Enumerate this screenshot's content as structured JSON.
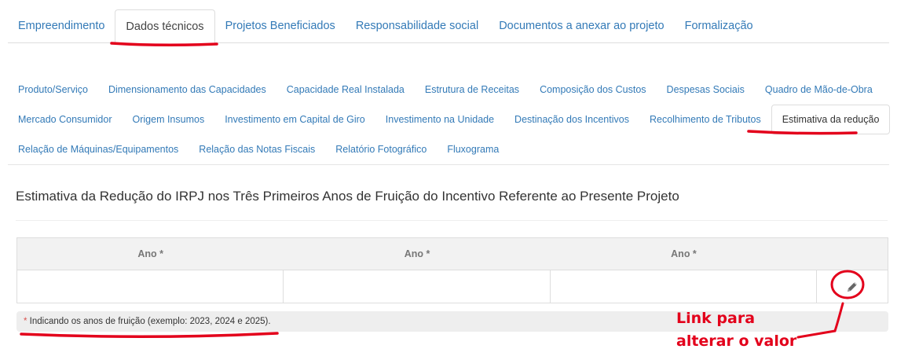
{
  "top_tabs": [
    {
      "label": "Empreendimento"
    },
    {
      "label": "Dados técnicos",
      "active": true
    },
    {
      "label": "Projetos Beneficiados"
    },
    {
      "label": "Responsabilidade social"
    },
    {
      "label": "Documentos a anexar ao projeto"
    },
    {
      "label": "Formalização"
    }
  ],
  "sub_tabs": {
    "row1": [
      "Produto/Serviço",
      "Dimensionamento das Capacidades",
      "Capacidade Real Instalada",
      "Estrutura de Receitas",
      "Composição dos Custos",
      "Despesas Sociais",
      "Quadro de Mão-de-Obra"
    ],
    "row2": [
      "Mercado Consumidor",
      "Origem Insumos",
      "Investimento em Capital de Giro",
      "Investimento na Unidade",
      "Destinação dos Incentivos",
      "Recolhimento de Tributos",
      "Estimativa da redução"
    ],
    "row3": [
      "Relação de Máquinas/Equipamentos",
      "Relação das Notas Fiscais",
      "Relatório Fotográfico",
      "Fluxograma"
    ],
    "active": "Estimativa da redução"
  },
  "panel": {
    "title": "Estimativa da Redução do IRPJ nos Três Primeiros Anos de Fruição do Incentivo Referente ao Presente Projeto",
    "columns": [
      "Ano *",
      "Ano *",
      "Ano *"
    ],
    "row": [
      "",
      "",
      ""
    ],
    "note_asterisk": "*",
    "note_text": " Indicando os anos de fruição (exemplo: 2023, 2024 e 2025)."
  },
  "icons": {
    "edit": "pencil-icon"
  },
  "annotation": {
    "line1": "Link para",
    "line2": "alterar o valor",
    "color": "#e3001b"
  }
}
